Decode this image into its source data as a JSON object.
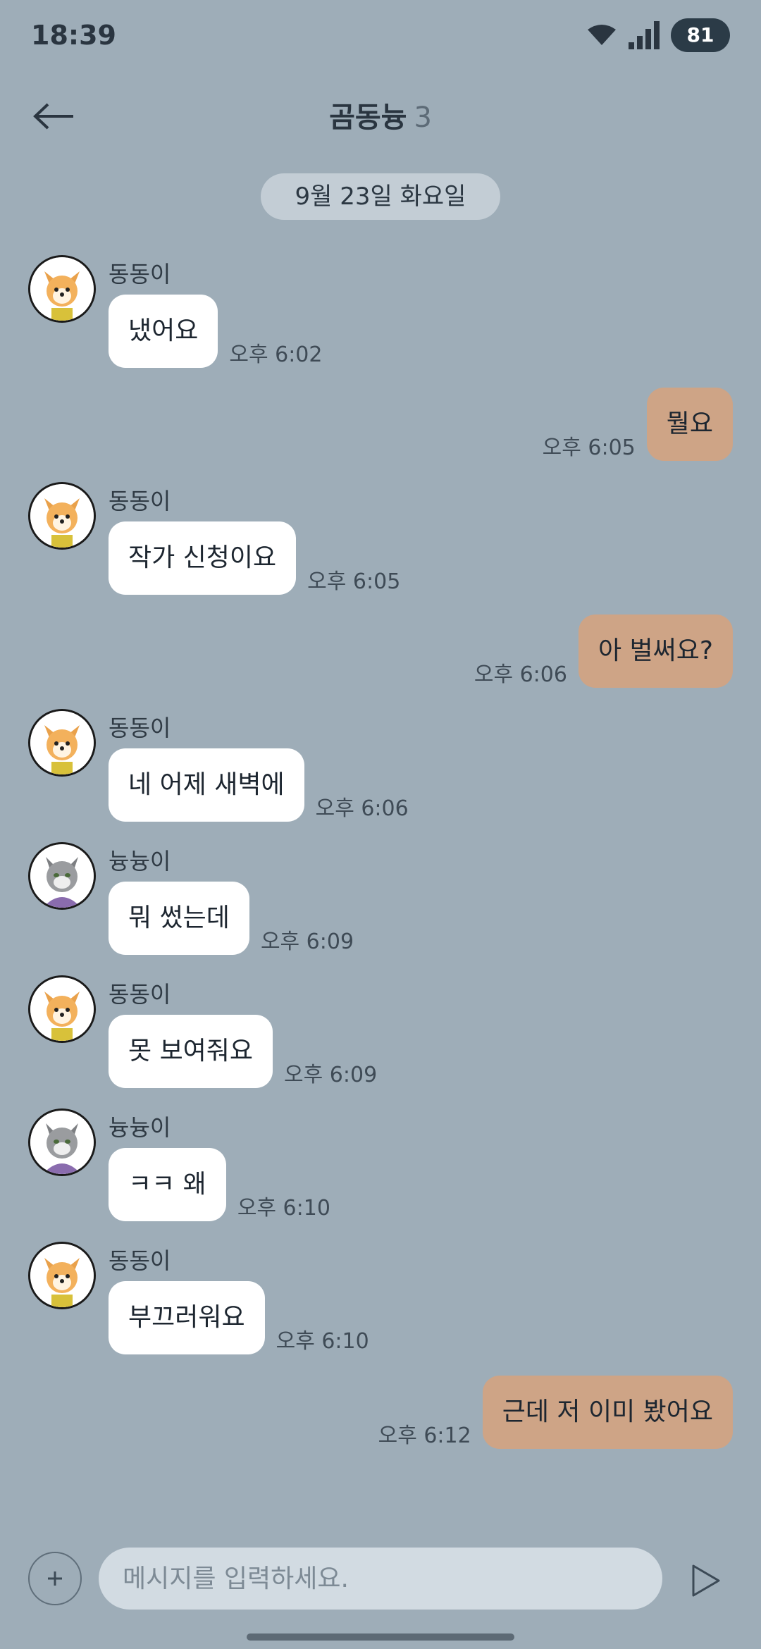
{
  "status": {
    "time": "18:39",
    "battery": "81"
  },
  "header": {
    "title": "곰동늉",
    "member_count": "3"
  },
  "date_separator": "9월 23일 화요일",
  "messages": [
    {
      "side": "in",
      "avatar": "dog-avatar",
      "sender": "동동이",
      "text": "냈어요",
      "time": "오후 6:02"
    },
    {
      "side": "out",
      "text": "뭘요",
      "time": "오후 6:05"
    },
    {
      "side": "in",
      "avatar": "dog-avatar",
      "sender": "동동이",
      "text": "작가 신청이요",
      "time": "오후 6:05"
    },
    {
      "side": "out",
      "text": "아 벌써요?",
      "time": "오후 6:06"
    },
    {
      "side": "in",
      "avatar": "dog-avatar",
      "sender": "동동이",
      "text": "네 어제 새벽에",
      "time": "오후 6:06"
    },
    {
      "side": "in",
      "avatar": "cat-avatar",
      "sender": "늉늉이",
      "text": "뭐 썼는데",
      "time": "오후 6:09"
    },
    {
      "side": "in",
      "avatar": "dog-avatar",
      "sender": "동동이",
      "text": "못 보여줘요",
      "time": "오후 6:09"
    },
    {
      "side": "in",
      "avatar": "cat-avatar",
      "sender": "늉늉이",
      "text": "ㅋㅋ 왜",
      "time": "오후 6:10"
    },
    {
      "side": "in",
      "avatar": "dog-avatar",
      "sender": "동동이",
      "text": "부끄러워요",
      "time": "오후 6:10"
    },
    {
      "side": "out",
      "text": "근데 저 이미 봤어요",
      "time": "오후 6:12"
    }
  ],
  "composer": {
    "placeholder": "메시지를 입력하세요."
  },
  "colors": {
    "background": "#9eadb8",
    "outgoing_bubble": "#cea486",
    "incoming_bubble": "#ffffff"
  }
}
